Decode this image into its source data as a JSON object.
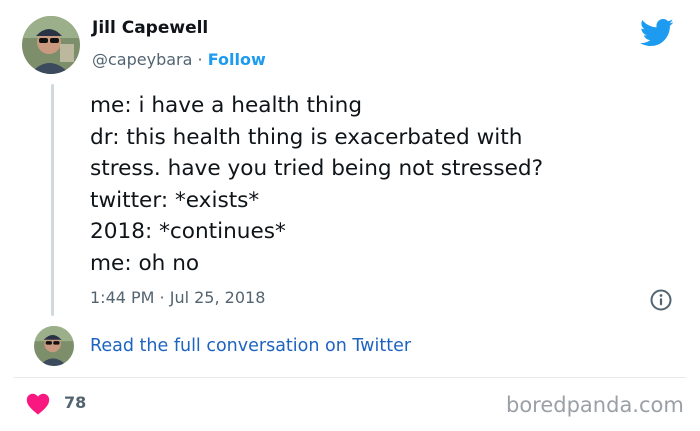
{
  "author": {
    "name": "Jill Capewell",
    "handle": "@capeybara",
    "separator": "·",
    "follow_label": "Follow"
  },
  "tweet": {
    "lines": [
      "me: i have a health thing",
      "dr: this health thing is exacerbated with",
      "stress. have you tried being not stressed?",
      "twitter: *exists*",
      "2018: *continues*",
      "me: oh no"
    ],
    "timestamp": "1:44 PM · Jul 25, 2018"
  },
  "conversation_link": "Read the full conversation on Twitter",
  "likes": "78",
  "watermark": "boredpanda.com",
  "colors": {
    "twitter_blue": "#1d9bf0",
    "link_blue": "#1d63c0",
    "heart_pink": "#f91880",
    "muted": "#536471"
  },
  "icons": [
    "twitter-bird-icon",
    "info-icon",
    "heart-icon"
  ]
}
